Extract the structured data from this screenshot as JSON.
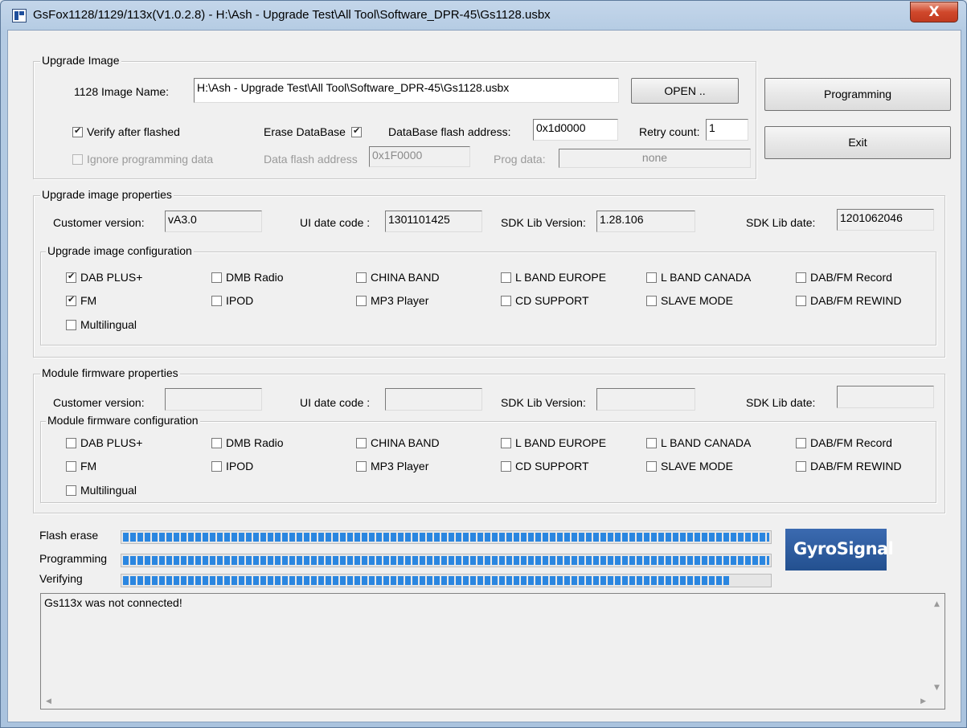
{
  "window": {
    "title": "GsFox1128/1129/113x(V1.0.2.8) - H:\\Ash - Upgrade Test\\All Tool\\Software_DPR-45\\Gs1128.usbx",
    "close_glyph": "X"
  },
  "upgrade_image": {
    "legend": "Upgrade Image",
    "name_label": "1128 Image Name:",
    "name_value": "H:\\Ash - Upgrade Test\\All Tool\\Software_DPR-45\\Gs1128.usbx",
    "open_button": "OPEN ..",
    "verify_label": "Verify after flashed",
    "verify_checked": true,
    "erase_label": "Erase DataBase",
    "erase_checked": true,
    "db_addr_label": "DataBase flash address:",
    "db_addr_value": "0x1d0000",
    "retry_label": "Retry count:",
    "retry_value": "1",
    "ignore_label": "Ignore programming data",
    "data_addr_label": "Data flash address",
    "data_addr_value": "0x1F0000",
    "prog_data_label": "Prog data:",
    "prog_data_value": "none"
  },
  "buttons": {
    "programming": "Programming",
    "exit": "Exit"
  },
  "image_props": {
    "legend": "Upgrade image properties",
    "customer_label": "Customer version:",
    "customer_value": "vA3.0",
    "ui_label": "UI date code :",
    "ui_value": "1301101425",
    "sdk_label": "SDK Lib Version:",
    "sdk_value": "1.28.106",
    "sdkdate_label": "SDK Lib date:",
    "sdkdate_value": "1201062046",
    "config_legend": "Upgrade image configuration",
    "options": [
      {
        "label": "DAB PLUS+",
        "checked": true
      },
      {
        "label": "DMB Radio",
        "checked": false
      },
      {
        "label": "CHINA BAND",
        "checked": false
      },
      {
        "label": "L BAND EUROPE",
        "checked": false
      },
      {
        "label": "L BAND CANADA",
        "checked": false
      },
      {
        "label": "DAB/FM Record",
        "checked": false
      },
      {
        "label": "FM",
        "checked": true
      },
      {
        "label": "IPOD",
        "checked": false
      },
      {
        "label": "MP3 Player",
        "checked": false
      },
      {
        "label": "CD SUPPORT",
        "checked": false
      },
      {
        "label": "SLAVE MODE",
        "checked": false
      },
      {
        "label": "DAB/FM REWIND",
        "checked": false
      },
      {
        "label": "Multilingual",
        "checked": false
      }
    ]
  },
  "module_props": {
    "legend": "Module firmware properties",
    "customer_label": "Customer version:",
    "customer_value": "",
    "ui_label": "UI date code :",
    "ui_value": "",
    "sdk_label": "SDK Lib Version:",
    "sdk_value": "",
    "sdkdate_label": "SDK Lib date:",
    "sdkdate_value": "",
    "config_legend": "Module firmware configuration",
    "options": [
      {
        "label": "DAB PLUS+",
        "checked": false
      },
      {
        "label": "DMB Radio",
        "checked": false
      },
      {
        "label": "CHINA BAND",
        "checked": false
      },
      {
        "label": "L BAND EUROPE",
        "checked": false
      },
      {
        "label": "L BAND CANADA",
        "checked": false
      },
      {
        "label": "DAB/FM Record",
        "checked": false
      },
      {
        "label": "FM",
        "checked": false
      },
      {
        "label": "IPOD",
        "checked": false
      },
      {
        "label": "MP3 Player",
        "checked": false
      },
      {
        "label": "CD SUPPORT",
        "checked": false
      },
      {
        "label": "SLAVE MODE",
        "checked": false
      },
      {
        "label": "DAB/FM REWIND",
        "checked": false
      },
      {
        "label": "Multilingual",
        "checked": false
      }
    ]
  },
  "progress": [
    {
      "label": "Flash erase",
      "fraction": 1.0
    },
    {
      "label": "Programming",
      "fraction": 1.0
    },
    {
      "label": "Verifying",
      "fraction": 0.94
    }
  ],
  "logo": {
    "text": "GyroSignal",
    "bg": "#2a5aa0"
  },
  "log": {
    "message": "Gs113x was not connected!"
  },
  "colors": {
    "progress_fill": "#2a86e0",
    "close_button": "#c84a30"
  }
}
